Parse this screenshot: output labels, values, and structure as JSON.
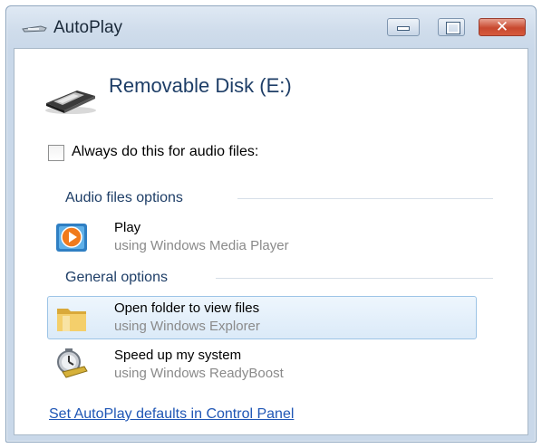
{
  "window": {
    "title": "AutoPlay",
    "title_icon": "autoplay-icon",
    "close_glyph": "✕"
  },
  "device": {
    "name": "Removable Disk (E:)",
    "icon": "removable-disk-icon"
  },
  "always_checkbox": {
    "label": "Always do this for audio files:",
    "checked": false
  },
  "groups": [
    {
      "header": "Audio files options",
      "options": [
        {
          "title": "Play",
          "subtitle": "using Windows Media Player",
          "icon": "media-player-icon",
          "selected": false
        }
      ]
    },
    {
      "header": "General options",
      "options": [
        {
          "title": "Open folder to view files",
          "subtitle": "using Windows Explorer",
          "icon": "folder-icon",
          "selected": true
        },
        {
          "title": "Speed up my system",
          "subtitle": "using Windows ReadyBoost",
          "icon": "readyboost-icon",
          "selected": false
        }
      ]
    }
  ],
  "footer": {
    "link": "Set AutoPlay defaults in Control Panel"
  },
  "colors": {
    "accent_text": "#1e3e67",
    "link": "#1f56b5",
    "selection_border": "#9dc4e6"
  }
}
